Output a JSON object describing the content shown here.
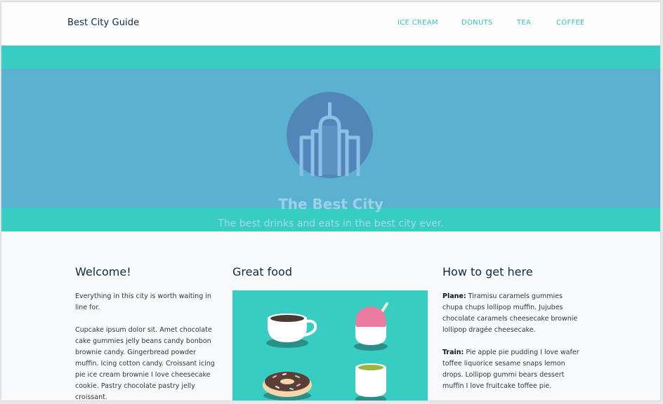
{
  "nav": {
    "brand": "Best City Guide",
    "links": [
      {
        "label": "ICE CREAM"
      },
      {
        "label": "DONUTS"
      },
      {
        "label": "TEA"
      },
      {
        "label": "COFFEE"
      }
    ]
  },
  "hero": {
    "icon": "building-icon",
    "title": "The Best City",
    "subtitle": "The best drinks and eats in the best city ever."
  },
  "welcome": {
    "heading": "Welcome!",
    "paragraphs": [
      "Everything in this city is worth waiting in line for.",
      "Cupcake ipsum dolor sit. Amet chocolate cake gummies jelly beans candy bonbon brownie candy. Gingerbread powder muffin. Icing cotton candy. Croissant icing pie ice cream brownie I love cheesecake cookie. Pastry chocolate pastry jelly croissant."
    ]
  },
  "food": {
    "heading": "Great food",
    "icons": [
      "coffee-cup-icon",
      "ice-cream-icon",
      "donut-icon",
      "tea-cup-icon"
    ]
  },
  "directions": {
    "heading": "How to get here",
    "items": [
      {
        "label": "Plane:",
        "text": "Tiramisu caramels gummies chupa chups lollipop muffin. Jujubes chocolate caramels cheesecake brownie lollipop dragée cheesecake."
      },
      {
        "label": "Train:",
        "text": "Pie apple pie pudding I love wafer toffee liquorice sesame snaps lemon drops. Lollipop gummi bears dessert muffin I love fruitcake toffee pie."
      }
    ]
  },
  "colors": {
    "accent_teal": "#38cdc2",
    "hero_band_blue": "#5bb1d0",
    "circle_blue": "#5286b8",
    "heading_navy": "#0f2a40"
  }
}
